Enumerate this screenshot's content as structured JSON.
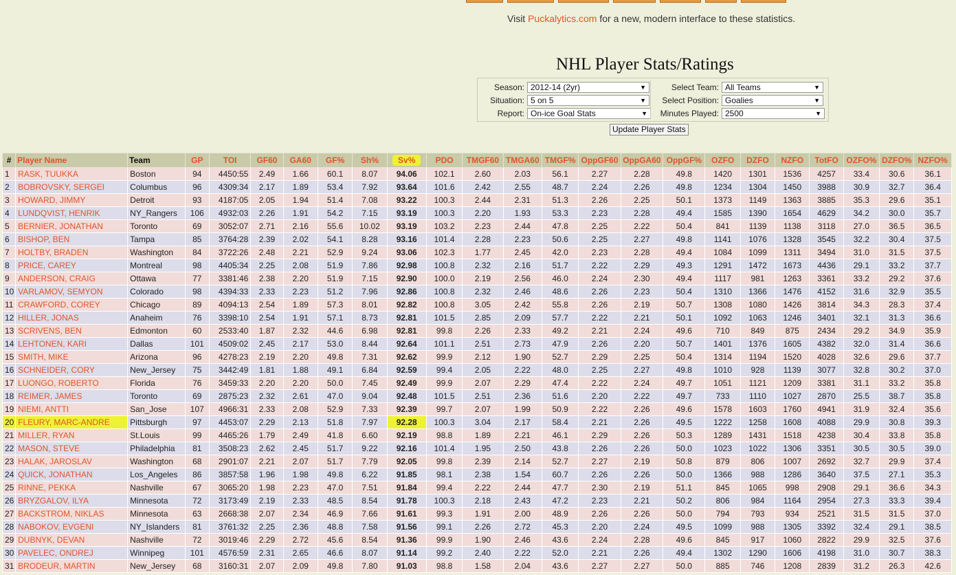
{
  "visit": {
    "prefix": "Visit ",
    "link": "Puckalytics.com",
    "suffix": " for a new, modern interface to these statistics."
  },
  "page_title": "NHL Player Stats/Ratings",
  "filters": {
    "season_label": "Season:",
    "season_value": "2012-14 (2yr)",
    "situation_label": "Situation:",
    "situation_value": "5 on 5",
    "report_label": "Report:",
    "report_value": "On-ice Goal Stats",
    "team_label": "Select Team:",
    "team_value": "All Teams",
    "position_label": "Select Position:",
    "position_value": "Goalies",
    "minutes_label": "Minutes Played:",
    "minutes_value": "2500"
  },
  "update_label": "Update Player Stats",
  "table": {
    "headers": [
      "#",
      "Player Name",
      "Team",
      "GP",
      "TOI",
      "GF60",
      "GA60",
      "GF%",
      "Sh%",
      "Sv%",
      "PDO",
      "TMGF60",
      "TMGA60",
      "TMGF%",
      "OppGF60",
      "OppGA60",
      "OppGF%",
      "OZFO",
      "DZFO",
      "NZFO",
      "TotFO",
      "OZFO%",
      "DZFO%",
      "NZFO%"
    ],
    "rows": [
      [
        "1",
        "RASK, TUUKKA",
        "Boston",
        "94",
        "4450:55",
        "2.49",
        "1.66",
        "60.1",
        "8.07",
        "94.06",
        "102.1",
        "2.60",
        "2.03",
        "56.1",
        "2.27",
        "2.28",
        "49.8",
        "1420",
        "1301",
        "1536",
        "4257",
        "33.4",
        "30.6",
        "36.1"
      ],
      [
        "2",
        "BOBROVSKY, SERGEI",
        "Columbus",
        "96",
        "4309:34",
        "2.17",
        "1.89",
        "53.4",
        "7.92",
        "93.64",
        "101.6",
        "2.42",
        "2.55",
        "48.7",
        "2.24",
        "2.26",
        "49.8",
        "1234",
        "1304",
        "1450",
        "3988",
        "30.9",
        "32.7",
        "36.4"
      ],
      [
        "3",
        "HOWARD, JIMMY",
        "Detroit",
        "93",
        "4187:05",
        "2.05",
        "1.94",
        "51.4",
        "7.08",
        "93.22",
        "100.3",
        "2.44",
        "2.31",
        "51.3",
        "2.26",
        "2.25",
        "50.1",
        "1373",
        "1149",
        "1363",
        "3885",
        "35.3",
        "29.6",
        "35.1"
      ],
      [
        "4",
        "LUNDQVIST, HENRIK",
        "NY_Rangers",
        "106",
        "4932:03",
        "2.26",
        "1.91",
        "54.2",
        "7.15",
        "93.19",
        "100.3",
        "2.20",
        "1.93",
        "53.3",
        "2.23",
        "2.28",
        "49.4",
        "1585",
        "1390",
        "1654",
        "4629",
        "34.2",
        "30.0",
        "35.7"
      ],
      [
        "5",
        "BERNIER, JONATHAN",
        "Toronto",
        "69",
        "3052:07",
        "2.71",
        "2.16",
        "55.6",
        "10.02",
        "93.19",
        "103.2",
        "2.23",
        "2.44",
        "47.8",
        "2.25",
        "2.22",
        "50.4",
        "841",
        "1139",
        "1138",
        "3118",
        "27.0",
        "36.5",
        "36.5"
      ],
      [
        "6",
        "BISHOP, BEN",
        "Tampa",
        "85",
        "3764:28",
        "2.39",
        "2.02",
        "54.1",
        "8.28",
        "93.16",
        "101.4",
        "2.28",
        "2.23",
        "50.6",
        "2.25",
        "2.27",
        "49.8",
        "1141",
        "1076",
        "1328",
        "3545",
        "32.2",
        "30.4",
        "37.5"
      ],
      [
        "7",
        "HOLTBY, BRADEN",
        "Washington",
        "84",
        "3722:26",
        "2.48",
        "2.21",
        "52.9",
        "9.24",
        "93.06",
        "102.3",
        "1.77",
        "2.45",
        "42.0",
        "2.23",
        "2.28",
        "49.4",
        "1084",
        "1099",
        "1311",
        "3494",
        "31.0",
        "31.5",
        "37.5"
      ],
      [
        "8",
        "PRICE, CAREY",
        "Montreal",
        "98",
        "4405:34",
        "2.25",
        "2.08",
        "51.9",
        "7.86",
        "92.98",
        "100.8",
        "2.32",
        "2.16",
        "51.7",
        "2.22",
        "2.29",
        "49.3",
        "1291",
        "1472",
        "1673",
        "4436",
        "29.1",
        "33.2",
        "37.7"
      ],
      [
        "9",
        "ANDERSON, CRAIG",
        "Ottawa",
        "77",
        "3381:46",
        "2.38",
        "2.20",
        "51.9",
        "7.15",
        "92.90",
        "100.0",
        "2.19",
        "2.56",
        "46.0",
        "2.24",
        "2.30",
        "49.4",
        "1117",
        "981",
        "1263",
        "3361",
        "33.2",
        "29.2",
        "37.6"
      ],
      [
        "10",
        "VARLAMOV, SEMYON",
        "Colorado",
        "98",
        "4394:33",
        "2.33",
        "2.23",
        "51.2",
        "7.96",
        "92.86",
        "100.8",
        "2.32",
        "2.46",
        "48.6",
        "2.26",
        "2.23",
        "50.4",
        "1310",
        "1366",
        "1476",
        "4152",
        "31.6",
        "32.9",
        "35.5"
      ],
      [
        "11",
        "CRAWFORD, COREY",
        "Chicago",
        "89",
        "4094:13",
        "2.54",
        "1.89",
        "57.3",
        "8.01",
        "92.82",
        "100.8",
        "3.05",
        "2.42",
        "55.8",
        "2.26",
        "2.19",
        "50.7",
        "1308",
        "1080",
        "1426",
        "3814",
        "34.3",
        "28.3",
        "37.4"
      ],
      [
        "12",
        "HILLER, JONAS",
        "Anaheim",
        "76",
        "3398:10",
        "2.54",
        "1.91",
        "57.1",
        "8.73",
        "92.81",
        "101.5",
        "2.85",
        "2.09",
        "57.7",
        "2.22",
        "2.21",
        "50.1",
        "1092",
        "1063",
        "1246",
        "3401",
        "32.1",
        "31.3",
        "36.6"
      ],
      [
        "13",
        "SCRIVENS, BEN",
        "Edmonton",
        "60",
        "2533:40",
        "1.87",
        "2.32",
        "44.6",
        "6.98",
        "92.81",
        "99.8",
        "2.26",
        "2.33",
        "49.2",
        "2.21",
        "2.24",
        "49.6",
        "710",
        "849",
        "875",
        "2434",
        "29.2",
        "34.9",
        "35.9"
      ],
      [
        "14",
        "LEHTONEN, KARI",
        "Dallas",
        "101",
        "4509:02",
        "2.45",
        "2.17",
        "53.0",
        "8.44",
        "92.64",
        "101.1",
        "2.51",
        "2.73",
        "47.9",
        "2.26",
        "2.20",
        "50.7",
        "1401",
        "1376",
        "1605",
        "4382",
        "32.0",
        "31.4",
        "36.6"
      ],
      [
        "15",
        "SMITH, MIKE",
        "Arizona",
        "96",
        "4278:23",
        "2.19",
        "2.20",
        "49.8",
        "7.31",
        "92.62",
        "99.9",
        "2.12",
        "1.90",
        "52.7",
        "2.29",
        "2.25",
        "50.4",
        "1314",
        "1194",
        "1520",
        "4028",
        "32.6",
        "29.6",
        "37.7"
      ],
      [
        "16",
        "SCHNEIDER, CORY",
        "New_Jersey",
        "75",
        "3442:49",
        "1.81",
        "1.88",
        "49.1",
        "6.84",
        "92.59",
        "99.4",
        "2.05",
        "2.22",
        "48.0",
        "2.25",
        "2.27",
        "49.8",
        "1010",
        "928",
        "1139",
        "3077",
        "32.8",
        "30.2",
        "37.0"
      ],
      [
        "17",
        "LUONGO, ROBERTO",
        "Florida",
        "76",
        "3459:33",
        "2.20",
        "2.20",
        "50.0",
        "7.45",
        "92.49",
        "99.9",
        "2.07",
        "2.29",
        "47.4",
        "2.22",
        "2.24",
        "49.7",
        "1051",
        "1121",
        "1209",
        "3381",
        "31.1",
        "33.2",
        "35.8"
      ],
      [
        "18",
        "REIMER, JAMES",
        "Toronto",
        "69",
        "2875:23",
        "2.32",
        "2.61",
        "47.0",
        "9.04",
        "92.48",
        "101.5",
        "2.51",
        "2.36",
        "51.6",
        "2.20",
        "2.22",
        "49.7",
        "733",
        "1110",
        "1027",
        "2870",
        "25.5",
        "38.7",
        "35.8"
      ],
      [
        "19",
        "NIEMI, ANTTI",
        "San_Jose",
        "107",
        "4966:31",
        "2.33",
        "2.08",
        "52.9",
        "7.33",
        "92.39",
        "99.7",
        "2.07",
        "1.99",
        "50.9",
        "2.22",
        "2.26",
        "49.6",
        "1578",
        "1603",
        "1760",
        "4941",
        "31.9",
        "32.4",
        "35.6"
      ],
      [
        "20",
        "FLEURY, MARC-ANDRE",
        "Pittsburgh",
        "97",
        "4453:07",
        "2.29",
        "2.13",
        "51.8",
        "7.97",
        "92.28",
        "100.3",
        "3.04",
        "2.17",
        "58.4",
        "2.21",
        "2.26",
        "49.5",
        "1222",
        "1258",
        "1608",
        "4088",
        "29.9",
        "30.8",
        "39.3"
      ],
      [
        "21",
        "MILLER, RYAN",
        "St.Louis",
        "99",
        "4465:26",
        "1.79",
        "2.49",
        "41.8",
        "6.60",
        "92.19",
        "98.8",
        "1.89",
        "2.21",
        "46.1",
        "2.29",
        "2.26",
        "50.3",
        "1289",
        "1431",
        "1518",
        "4238",
        "30.4",
        "33.8",
        "35.8"
      ],
      [
        "22",
        "MASON, STEVE",
        "Philadelphia",
        "81",
        "3508:23",
        "2.62",
        "2.45",
        "51.7",
        "9.22",
        "92.16",
        "101.4",
        "1.95",
        "2.50",
        "43.8",
        "2.26",
        "2.26",
        "50.0",
        "1023",
        "1022",
        "1306",
        "3351",
        "30.5",
        "30.5",
        "39.0"
      ],
      [
        "23",
        "HALAK, JAROSLAV",
        "Washington",
        "68",
        "2901:07",
        "2.21",
        "2.07",
        "51.7",
        "7.79",
        "92.05",
        "99.8",
        "2.39",
        "2.14",
        "52.7",
        "2.27",
        "2.19",
        "50.8",
        "879",
        "806",
        "1007",
        "2692",
        "32.7",
        "29.9",
        "37.4"
      ],
      [
        "24",
        "QUICK, JONATHAN",
        "Los_Angeles",
        "86",
        "3857:58",
        "1.96",
        "1.98",
        "49.8",
        "6.22",
        "91.85",
        "98.1",
        "2.38",
        "1.54",
        "60.7",
        "2.26",
        "2.26",
        "50.0",
        "1366",
        "988",
        "1286",
        "3640",
        "37.5",
        "27.1",
        "35.3"
      ],
      [
        "25",
        "RINNE, PEKKA",
        "Nashville",
        "67",
        "3065:20",
        "1.98",
        "2.23",
        "47.0",
        "7.51",
        "91.84",
        "99.4",
        "2.22",
        "2.44",
        "47.7",
        "2.30",
        "2.19",
        "51.1",
        "845",
        "1065",
        "998",
        "2908",
        "29.1",
        "36.6",
        "34.3"
      ],
      [
        "26",
        "BRYZGALOV, ILYA",
        "Minnesota",
        "72",
        "3173:49",
        "2.19",
        "2.33",
        "48.5",
        "8.54",
        "91.78",
        "100.3",
        "2.18",
        "2.43",
        "47.2",
        "2.23",
        "2.21",
        "50.2",
        "806",
        "984",
        "1164",
        "2954",
        "27.3",
        "33.3",
        "39.4"
      ],
      [
        "27",
        "BACKSTROM, NIKLAS",
        "Minnesota",
        "63",
        "2668:38",
        "2.07",
        "2.34",
        "46.9",
        "7.66",
        "91.61",
        "99.3",
        "1.91",
        "2.00",
        "48.9",
        "2.26",
        "2.26",
        "50.0",
        "794",
        "793",
        "934",
        "2521",
        "31.5",
        "31.5",
        "37.0"
      ],
      [
        "28",
        "NABOKOV, EVGENI",
        "NY_Islanders",
        "81",
        "3761:32",
        "2.25",
        "2.36",
        "48.8",
        "7.58",
        "91.56",
        "99.1",
        "2.26",
        "2.72",
        "45.3",
        "2.20",
        "2.24",
        "49.5",
        "1099",
        "988",
        "1305",
        "3392",
        "32.4",
        "29.1",
        "38.5"
      ],
      [
        "29",
        "DUBNYK, DEVAN",
        "Nashville",
        "72",
        "3019:46",
        "2.29",
        "2.72",
        "45.6",
        "8.54",
        "91.36",
        "99.9",
        "1.90",
        "2.46",
        "43.6",
        "2.24",
        "2.28",
        "49.6",
        "845",
        "917",
        "1060",
        "2822",
        "29.9",
        "32.5",
        "37.6"
      ],
      [
        "30",
        "PAVELEC, ONDREJ",
        "Winnipeg",
        "101",
        "4576:59",
        "2.31",
        "2.65",
        "46.6",
        "8.07",
        "91.14",
        "99.2",
        "2.40",
        "2.22",
        "52.0",
        "2.21",
        "2.26",
        "49.4",
        "1302",
        "1290",
        "1606",
        "4198",
        "31.0",
        "30.7",
        "38.3"
      ],
      [
        "31",
        "BRODEUR, MARTIN",
        "New_Jersey",
        "68",
        "3160:31",
        "2.07",
        "2.09",
        "49.8",
        "7.80",
        "91.03",
        "98.8",
        "1.58",
        "2.04",
        "43.6",
        "2.27",
        "2.27",
        "50.0",
        "885",
        "746",
        "1208",
        "2839",
        "31.2",
        "26.3",
        "42.6"
      ]
    ]
  }
}
